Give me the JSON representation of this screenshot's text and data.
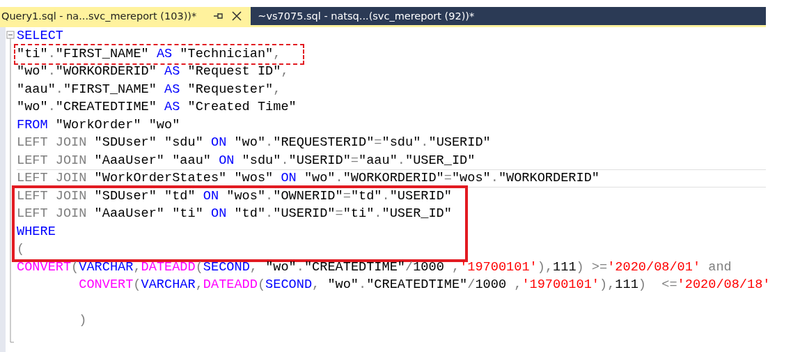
{
  "tabs": [
    {
      "label": "Query1.sql - na...svc_mereport (103))*",
      "selected": true
    },
    {
      "label": "~vs7075.sql - natsq...(svc_mereport (92))*",
      "selected": false
    }
  ],
  "editor": {
    "lines": [
      {
        "tokens": [
          {
            "kind": "kw",
            "text": "SELECT"
          }
        ]
      },
      {
        "selected": true,
        "tokens": [
          {
            "kind": "id",
            "text": "\"ti\""
          },
          {
            "kind": "op",
            "text": "."
          },
          {
            "kind": "id",
            "text": "\"FIRST_NAME\" "
          },
          {
            "kind": "kw",
            "text": "AS"
          },
          {
            "kind": "id",
            "text": " \"Technician\""
          },
          {
            "kind": "op",
            "text": ","
          }
        ]
      },
      {
        "tokens": [
          {
            "kind": "id",
            "text": "\"wo\""
          },
          {
            "kind": "op",
            "text": "."
          },
          {
            "kind": "id",
            "text": "\"WORKORDERID\" "
          },
          {
            "kind": "kw",
            "text": "AS"
          },
          {
            "kind": "id",
            "text": " \"Request ID\""
          },
          {
            "kind": "op",
            "text": ","
          }
        ]
      },
      {
        "tokens": [
          {
            "kind": "id",
            "text": "\"aau\""
          },
          {
            "kind": "op",
            "text": "."
          },
          {
            "kind": "id",
            "text": "\"FIRST_NAME\" "
          },
          {
            "kind": "kw",
            "text": "AS"
          },
          {
            "kind": "id",
            "text": " \"Requester\""
          },
          {
            "kind": "op",
            "text": ","
          }
        ]
      },
      {
        "tokens": [
          {
            "kind": "id",
            "text": "\"wo\""
          },
          {
            "kind": "op",
            "text": "."
          },
          {
            "kind": "id",
            "text": "\"CREATEDTIME\" "
          },
          {
            "kind": "kw",
            "text": "AS"
          },
          {
            "kind": "id",
            "text": " \"Created Time\""
          }
        ]
      },
      {
        "tokens": [
          {
            "kind": "kw",
            "text": "FROM"
          },
          {
            "kind": "id",
            "text": " \"WorkOrder\" \"wo\""
          }
        ]
      },
      {
        "tokens": [
          {
            "kind": "op",
            "text": "LEFT JOIN"
          },
          {
            "kind": "id",
            "text": " \"SDUser\" \"sdu\" "
          },
          {
            "kind": "kw",
            "text": "ON"
          },
          {
            "kind": "id",
            "text": " \"wo\""
          },
          {
            "kind": "op",
            "text": "."
          },
          {
            "kind": "id",
            "text": "\"REQUESTERID\""
          },
          {
            "kind": "op",
            "text": "="
          },
          {
            "kind": "id",
            "text": "\"sdu\""
          },
          {
            "kind": "op",
            "text": "."
          },
          {
            "kind": "id",
            "text": "\"USERID\""
          }
        ]
      },
      {
        "tokens": [
          {
            "kind": "op",
            "text": "LEFT JOIN"
          },
          {
            "kind": "id",
            "text": " \"AaaUser\" \"aau\" "
          },
          {
            "kind": "kw",
            "text": "ON"
          },
          {
            "kind": "id",
            "text": " \"sdu\""
          },
          {
            "kind": "op",
            "text": "."
          },
          {
            "kind": "id",
            "text": "\"USERID\""
          },
          {
            "kind": "op",
            "text": "="
          },
          {
            "kind": "id",
            "text": "\"aau\""
          },
          {
            "kind": "op",
            "text": "."
          },
          {
            "kind": "id",
            "text": "\"USER_ID\""
          }
        ]
      },
      {
        "current": true,
        "tokens": [
          {
            "kind": "op",
            "text": "LEFT JOIN"
          },
          {
            "kind": "id",
            "text": " \"WorkOrderStates\" \"wos\" "
          },
          {
            "kind": "kw",
            "text": "ON"
          },
          {
            "kind": "id",
            "text": " \"wo\""
          },
          {
            "kind": "op",
            "text": "."
          },
          {
            "kind": "id",
            "text": "\"WORKORDERID\""
          },
          {
            "kind": "op",
            "text": "="
          },
          {
            "kind": "id",
            "text": "\"wos\""
          },
          {
            "kind": "op",
            "text": "."
          },
          {
            "kind": "id",
            "text": "\"WORKORDERID\""
          }
        ]
      },
      {
        "boxed": true,
        "tokens": [
          {
            "kind": "op",
            "text": "LEFT JOIN"
          },
          {
            "kind": "id",
            "text": " \"SDUser\" \"td\" "
          },
          {
            "kind": "kw",
            "text": "ON"
          },
          {
            "kind": "id",
            "text": " \"wos\""
          },
          {
            "kind": "op",
            "text": "."
          },
          {
            "kind": "id",
            "text": "\"OWNERID\""
          },
          {
            "kind": "op",
            "text": "="
          },
          {
            "kind": "id",
            "text": "\"td\""
          },
          {
            "kind": "op",
            "text": "."
          },
          {
            "kind": "id",
            "text": "\"USERID\""
          }
        ]
      },
      {
        "boxed": true,
        "tokens": [
          {
            "kind": "op",
            "text": "LEFT JOIN"
          },
          {
            "kind": "id",
            "text": " \"AaaUser\" \"ti\" "
          },
          {
            "kind": "kw",
            "text": "ON"
          },
          {
            "kind": "id",
            "text": " \"td\""
          },
          {
            "kind": "op",
            "text": "."
          },
          {
            "kind": "id",
            "text": "\"USERID\""
          },
          {
            "kind": "op",
            "text": "="
          },
          {
            "kind": "id",
            "text": "\"ti\""
          },
          {
            "kind": "op",
            "text": "."
          },
          {
            "kind": "id",
            "text": "\"USER_ID\""
          }
        ]
      },
      {
        "boxed": true,
        "tokens": [
          {
            "kind": "kw",
            "text": "WHERE"
          }
        ]
      },
      {
        "boxed": true,
        "tokens": [
          {
            "kind": "op",
            "text": "("
          }
        ]
      },
      {
        "tokens": [
          {
            "kind": "fn",
            "text": "CONVERT"
          },
          {
            "kind": "op",
            "text": "("
          },
          {
            "kind": "kw",
            "text": "VARCHAR"
          },
          {
            "kind": "op",
            "text": ","
          },
          {
            "kind": "fn",
            "text": "DATEADD"
          },
          {
            "kind": "op",
            "text": "("
          },
          {
            "kind": "kw",
            "text": "SECOND"
          },
          {
            "kind": "op",
            "text": ", "
          },
          {
            "kind": "id",
            "text": "\"wo\""
          },
          {
            "kind": "op",
            "text": "."
          },
          {
            "kind": "id",
            "text": "\"CREATEDTIME\""
          },
          {
            "kind": "op",
            "text": "/"
          },
          {
            "kind": "id",
            "text": "1000 "
          },
          {
            "kind": "op",
            "text": ","
          },
          {
            "kind": "lit",
            "text": "'19700101'"
          },
          {
            "kind": "op",
            "text": "),"
          },
          {
            "kind": "id",
            "text": "111"
          },
          {
            "kind": "op",
            "text": ") >="
          },
          {
            "kind": "lit",
            "text": "'2020/08/01'"
          },
          {
            "kind": "op",
            "text": " and"
          }
        ]
      },
      {
        "indented": true,
        "tokens": [
          {
            "kind": "fn",
            "text": "CONVERT"
          },
          {
            "kind": "op",
            "text": "("
          },
          {
            "kind": "kw",
            "text": "VARCHAR"
          },
          {
            "kind": "op",
            "text": ","
          },
          {
            "kind": "fn",
            "text": "DATEADD"
          },
          {
            "kind": "op",
            "text": "("
          },
          {
            "kind": "kw",
            "text": "SECOND"
          },
          {
            "kind": "op",
            "text": ", "
          },
          {
            "kind": "id",
            "text": "\"wo\""
          },
          {
            "kind": "op",
            "text": "."
          },
          {
            "kind": "id",
            "text": "\"CREATEDTIME\""
          },
          {
            "kind": "op",
            "text": "/"
          },
          {
            "kind": "id",
            "text": "1000 "
          },
          {
            "kind": "op",
            "text": ","
          },
          {
            "kind": "lit",
            "text": "'19700101'"
          },
          {
            "kind": "op",
            "text": "),"
          },
          {
            "kind": "id",
            "text": "111"
          },
          {
            "kind": "op",
            "text": ")  <="
          },
          {
            "kind": "lit",
            "text": "'2020/08/18'"
          }
        ]
      },
      {
        "indented": true,
        "gap_before": true,
        "tokens": [
          {
            "kind": "op",
            "text": ")"
          }
        ]
      }
    ]
  }
}
